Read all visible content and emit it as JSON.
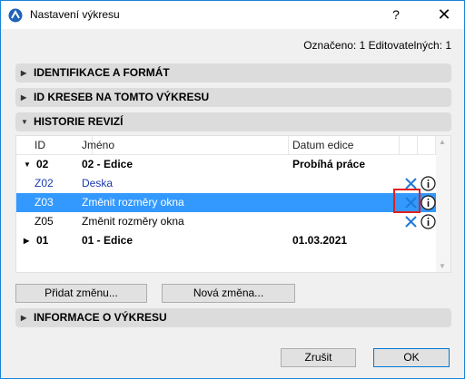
{
  "window": {
    "title": "Nastavení výkresu",
    "help": "?",
    "close": "✕"
  },
  "selection_info": "Označeno: 1 Editovatelných: 1",
  "sections": {
    "identification": "IDENTIFIKACE A FORMÁT",
    "drawing_ids": "ID KRESEB NA TOMTO VÝKRESU",
    "revision_history": "HISTORIE REVIZÍ",
    "drawing_info": "INFORMACE O VÝKRESU"
  },
  "table": {
    "headers": {
      "id": "ID",
      "name": "Jméno",
      "date": "Datum edice"
    },
    "rows": [
      {
        "id": "02",
        "name": "02 - Edice",
        "date": "Probíhá práce"
      },
      {
        "id": "Z02",
        "name": "Deska",
        "date": ""
      },
      {
        "id": "Z03",
        "name": "Změnit rozměry okna",
        "date": ""
      },
      {
        "id": "Z05",
        "name": "Změnit rozměry okna",
        "date": ""
      },
      {
        "id": "01",
        "name": "01 - Edice",
        "date": "01.03.2021"
      }
    ]
  },
  "buttons": {
    "add_change": "Přidat změnu...",
    "new_change": "Nová změna...",
    "cancel": "Zrušit",
    "ok": "OK"
  },
  "colors": {
    "selection": "#3399ff",
    "link": "#1a3aad",
    "delete_icon": "#1e7bd6",
    "highlight": "#e0201e",
    "window_border": "#1883d7"
  },
  "icons": [
    "archicad-app-icon",
    "delete-icon",
    "info-icon",
    "expand-triangle-icon",
    "collapse-triangle-icon"
  ]
}
